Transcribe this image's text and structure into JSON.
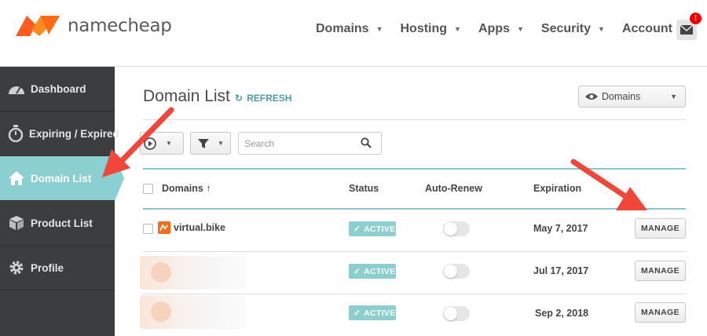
{
  "brand": {
    "name": "namecheap",
    "accent": "#ff6a13"
  },
  "nav": [
    {
      "label": "Domains"
    },
    {
      "label": "Hosting"
    },
    {
      "label": "Apps"
    },
    {
      "label": "Security"
    },
    {
      "label": "Account"
    }
  ],
  "notifications": {
    "badge": "!",
    "icon": "mail-icon"
  },
  "sidebar": {
    "items": [
      {
        "label": "Dashboard",
        "icon": "gauge-icon"
      },
      {
        "label": "Expiring / Expired",
        "icon": "stopwatch-icon"
      },
      {
        "label": "Domain List",
        "icon": "home-icon",
        "active": true
      },
      {
        "label": "Product List",
        "icon": "box-icon"
      },
      {
        "label": "Profile",
        "icon": "gear-icon"
      }
    ]
  },
  "main": {
    "title": "Domain List",
    "refresh_label": "REFRESH",
    "view_dropdown": "Domains",
    "search_placeholder": "Search"
  },
  "table": {
    "headers": {
      "domains": "Domains ↑",
      "status": "Status",
      "auto_renew": "Auto-Renew",
      "expiration": "Expiration"
    },
    "rows": [
      {
        "domain": "virtual.bike",
        "status": "ACTIVE",
        "auto_renew": false,
        "expiration": "May 7, 2017",
        "action": "MANAGE"
      },
      {
        "domain": "",
        "status": "ACTIVE",
        "auto_renew": false,
        "expiration": "Jul 17, 2017",
        "action": "MANAGE"
      },
      {
        "domain": "",
        "status": "ACTIVE",
        "auto_renew": false,
        "expiration": "Sep 2, 2018",
        "action": "MANAGE"
      }
    ]
  },
  "colors": {
    "sidebar_bg": "#3c3d3f",
    "active_teal": "#8ccfd0",
    "annotation_arrow": "#f0473a"
  }
}
